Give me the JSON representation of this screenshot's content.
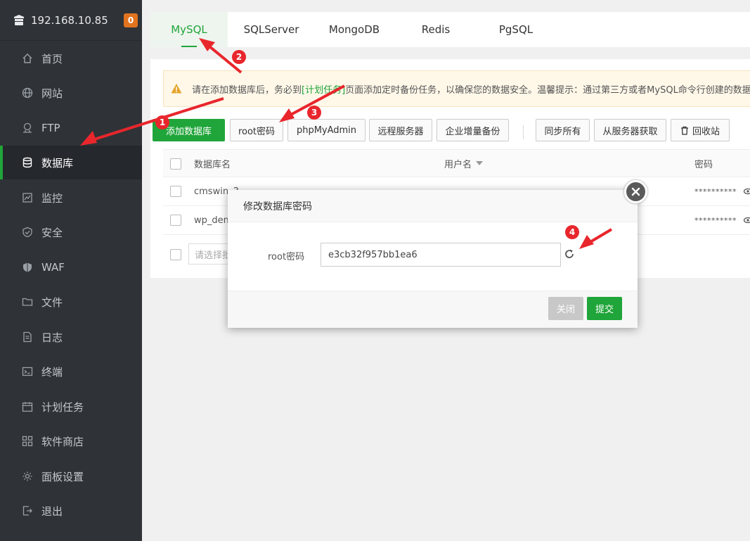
{
  "sidebar": {
    "host": "192.168.10.85",
    "badge": "0",
    "items": [
      {
        "label": "首页",
        "icon": "home-icon"
      },
      {
        "label": "网站",
        "icon": "globe-icon"
      },
      {
        "label": "FTP",
        "icon": "ftp-icon"
      },
      {
        "label": "数据库",
        "icon": "database-icon"
      },
      {
        "label": "监控",
        "icon": "monitor-icon"
      },
      {
        "label": "安全",
        "icon": "shield-icon"
      },
      {
        "label": "WAF",
        "icon": "waf-shield-icon"
      },
      {
        "label": "文件",
        "icon": "folder-icon"
      },
      {
        "label": "日志",
        "icon": "log-icon"
      },
      {
        "label": "终端",
        "icon": "terminal-icon"
      },
      {
        "label": "计划任务",
        "icon": "calendar-icon"
      },
      {
        "label": "软件商店",
        "icon": "grid-icon"
      },
      {
        "label": "面板设置",
        "icon": "gear-icon"
      },
      {
        "label": "退出",
        "icon": "logout-icon"
      }
    ],
    "active_index": 3
  },
  "tabs": [
    "MySQL",
    "SQLServer",
    "MongoDB",
    "Redis",
    "PgSQL"
  ],
  "notice": {
    "before": "请在添加数据库后，务必到",
    "link": "[计划任务]",
    "after": "页面添加定时备份任务，以确保您的数据安全。温馨提示：通过第三方或者MySQL命令行创建的数据"
  },
  "toolbar": {
    "add": "添加数据库",
    "root_pwd": "root密码",
    "phpmyadmin": "phpMyAdmin",
    "remote": "远程服务器",
    "incremental": "企业增量备份",
    "sync_all": "同步所有",
    "fetch": "从服务器获取",
    "recycle": "回收站"
  },
  "table": {
    "col_name": "数据库名",
    "col_user": "用户名",
    "col_pwd": "密码",
    "rows": [
      {
        "name": "cmswin_3",
        "pwd": "**********"
      },
      {
        "name": "wp_dem",
        "pwd": "**********"
      }
    ],
    "batch_placeholder": "请选择批"
  },
  "dialog": {
    "title": "修改数据库密码",
    "label": "root密码",
    "value": "e3cb32f957bb1ea6",
    "close": "关闭",
    "submit": "提交"
  },
  "markers": [
    "1",
    "2",
    "3",
    "4"
  ],
  "colors": {
    "accent": "#20a53a",
    "sidebar": "#2f3337",
    "marker": "#e8262c",
    "badge": "#e2731f"
  }
}
